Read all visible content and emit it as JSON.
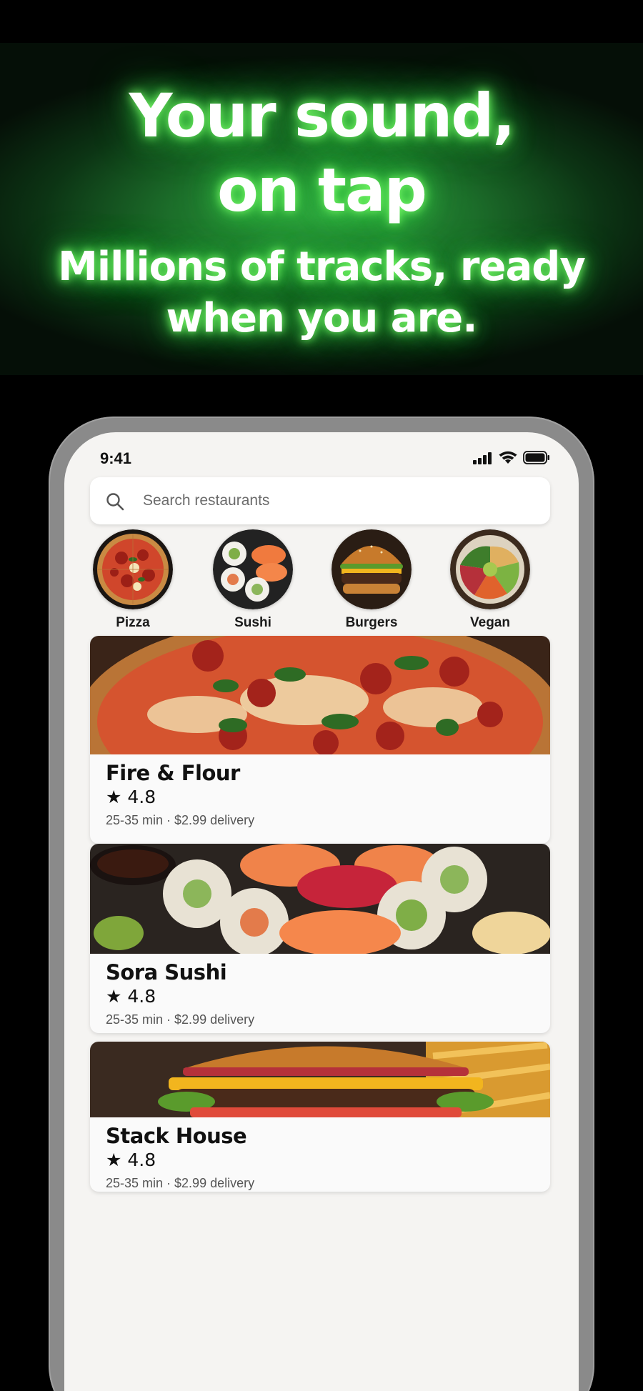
{
  "promo": {
    "headline_line1": "Your sound,",
    "headline_line2": "on tap",
    "subline_line1": "Millions of tracks, ready",
    "subline_line2": "when you are."
  },
  "status_bar": {
    "time": "9:41",
    "icons": [
      "cellular-signal-icon",
      "wifi-icon",
      "battery-icon"
    ]
  },
  "search": {
    "placeholder": "Search restaurants",
    "icon": "search-icon"
  },
  "categories": [
    {
      "label": "Pizza",
      "icon": "pizza-image"
    },
    {
      "label": "Sushi",
      "icon": "sushi-image"
    },
    {
      "label": "Burgers",
      "icon": "burger-image"
    },
    {
      "label": "Vegan",
      "icon": "vegan-bowl-image"
    }
  ],
  "restaurants": [
    {
      "name": "Fire & Flour",
      "rating": "★ 4.8",
      "meta": "25-35 min · $2.99 delivery",
      "image": "pizza-photo"
    },
    {
      "name": "Sora Sushi",
      "rating": "★ 4.8",
      "meta": "25-35 min · $2.99 delivery",
      "image": "sushi-photo"
    },
    {
      "name": "Stack House",
      "rating": "★ 4.8",
      "meta": "25-35 min · $2.99 delivery",
      "image": "burger-photo"
    }
  ],
  "colors": {
    "glow_green": "#3ee04b",
    "banner_green": "#1c6e2a",
    "screen_bg": "#f5f4f2",
    "phone_frame": "#8a8a8a"
  }
}
